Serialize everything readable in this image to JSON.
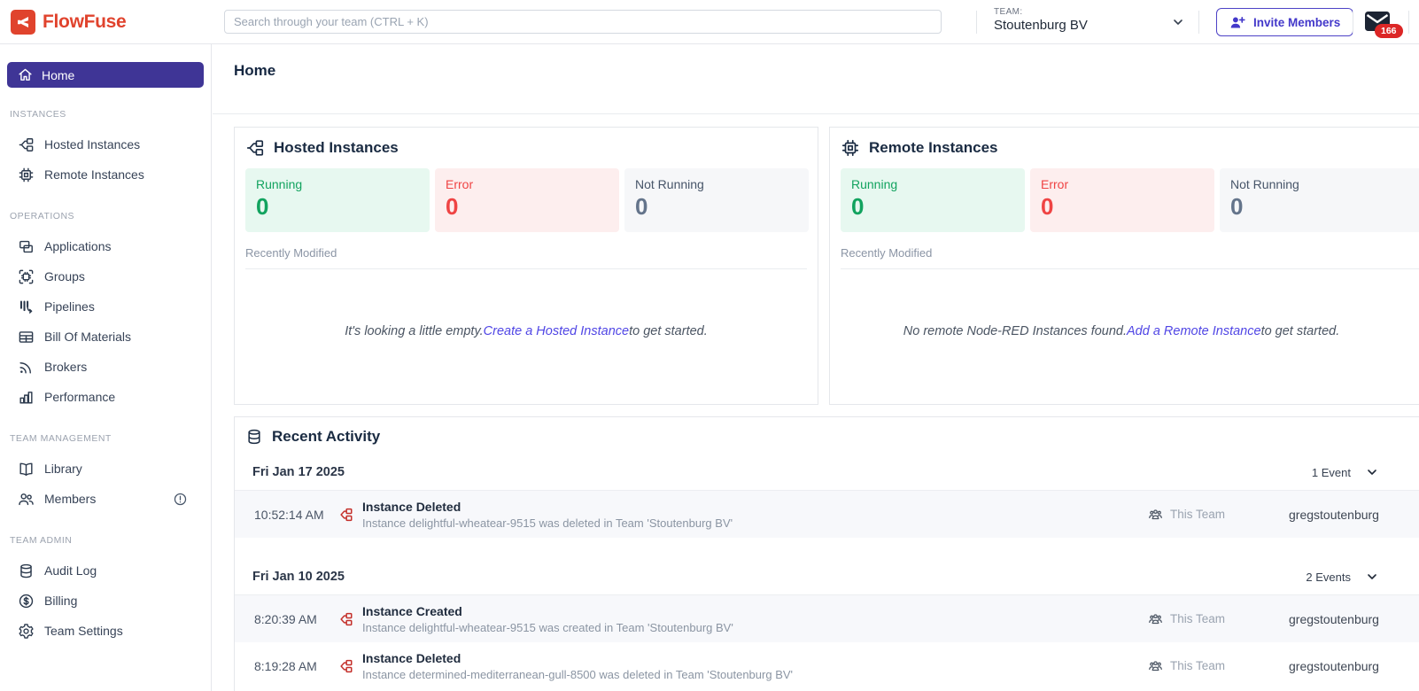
{
  "brand": {
    "name": "FlowFuse",
    "color": "#e0432d"
  },
  "header": {
    "search_placeholder": "Search through your team (CTRL + K)",
    "team_label": "TEAM:",
    "team_name": "Stoutenburg BV",
    "invite_label": "Invite Members",
    "notification_count": "166"
  },
  "colors": {
    "accent_indigo": "#3f3596",
    "link": "#5046e5",
    "brand_red": "#e0432d",
    "status_green": "#12a35f",
    "status_red": "#ef4444",
    "badge_red": "#dc2626"
  },
  "sidebar": {
    "home_label": "Home",
    "sections": [
      {
        "title": "INSTANCES",
        "items": [
          {
            "label": "Hosted Instances"
          },
          {
            "label": "Remote Instances"
          }
        ]
      },
      {
        "title": "OPERATIONS",
        "items": [
          {
            "label": "Applications"
          },
          {
            "label": "Groups"
          },
          {
            "label": "Pipelines"
          },
          {
            "label": "Bill Of Materials"
          },
          {
            "label": "Brokers"
          },
          {
            "label": "Performance"
          }
        ]
      },
      {
        "title": "TEAM MANAGEMENT",
        "items": [
          {
            "label": "Library"
          },
          {
            "label": "Members"
          }
        ]
      },
      {
        "title": "TEAM ADMIN",
        "items": [
          {
            "label": "Audit Log"
          },
          {
            "label": "Billing"
          },
          {
            "label": "Team Settings"
          }
        ]
      }
    ]
  },
  "main": {
    "page_title": "Home",
    "hosted_card": {
      "title": "Hosted Instances",
      "stats": [
        {
          "label": "Running",
          "value": "0"
        },
        {
          "label": "Error",
          "value": "0"
        },
        {
          "label": "Not Running",
          "value": "0"
        }
      ],
      "recently_modified_label": "Recently Modified",
      "empty_prefix": "It's looking a little empty. ",
      "empty_link": "Create a Hosted Instance",
      "empty_suffix": " to get started."
    },
    "remote_card": {
      "title": "Remote Instances",
      "stats": [
        {
          "label": "Running",
          "value": "0"
        },
        {
          "label": "Error",
          "value": "0"
        },
        {
          "label": "Not Running",
          "value": "0"
        }
      ],
      "recently_modified_label": "Recently Modified",
      "empty_prefix": "No remote Node-RED Instances found. ",
      "empty_link": "Add a Remote Instance",
      "empty_suffix": " to get started."
    },
    "activity": {
      "title": "Recent Activity",
      "groups": [
        {
          "date": "Fri Jan 17 2025",
          "count_label": "1 Event",
          "events": [
            {
              "time": "10:52:14 AM",
              "title": "Instance Deleted",
              "desc": "Instance delightful-wheatear-9515 was deleted in Team 'Stoutenburg BV'",
              "scope": "This Team",
              "user": "gregstoutenburg"
            }
          ]
        },
        {
          "date": "Fri Jan 10 2025",
          "count_label": "2 Events",
          "events": [
            {
              "time": "8:20:39 AM",
              "title": "Instance Created",
              "desc": "Instance delightful-wheatear-9515 was created in Team 'Stoutenburg BV'",
              "scope": "This Team",
              "user": "gregstoutenburg"
            },
            {
              "time": "8:19:28 AM",
              "title": "Instance Deleted",
              "desc": "Instance determined-mediterranean-gull-8500 was deleted in Team 'Stoutenburg BV'",
              "scope": "This Team",
              "user": "gregstoutenburg"
            }
          ]
        }
      ]
    }
  }
}
